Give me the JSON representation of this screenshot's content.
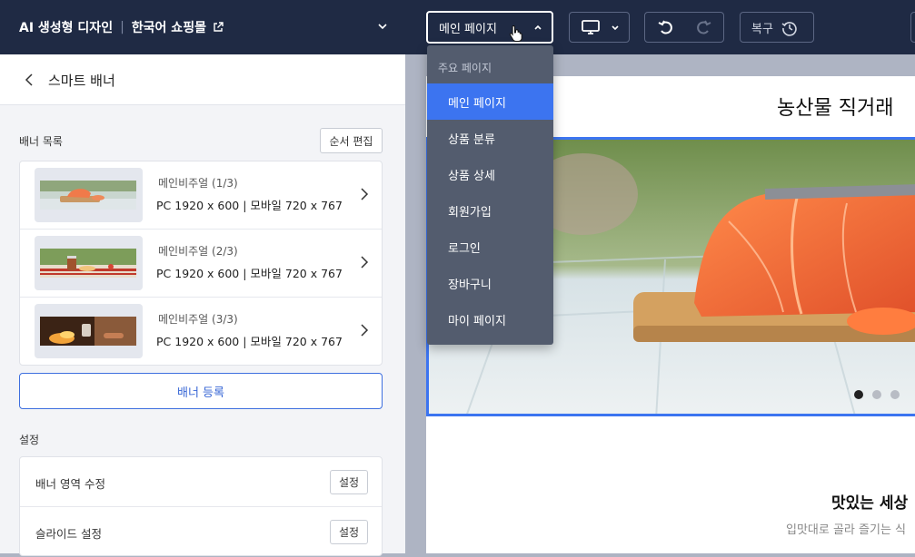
{
  "topbar": {
    "app_title": "AI 생성형 디자인",
    "separator": "|",
    "shop_name": "한국어 쇼핑몰",
    "page_select_value": "메인 페이지",
    "restore_label": "복구"
  },
  "page_dropdown": {
    "group_label": "주요 페이지",
    "items": [
      {
        "label": "메인 페이지",
        "selected": true
      },
      {
        "label": "상품 분류",
        "selected": false
      },
      {
        "label": "상품 상세",
        "selected": false
      },
      {
        "label": "회원가입",
        "selected": false
      },
      {
        "label": "로그인",
        "selected": false
      },
      {
        "label": "장바구니",
        "selected": false
      },
      {
        "label": "마이 페이지",
        "selected": false
      }
    ]
  },
  "panel": {
    "title": "스마트 배너",
    "banner_list_label": "배너 목록",
    "order_edit_label": "순서 편집",
    "banners": [
      {
        "name": "메인비주얼 (1/3)",
        "size": "PC 1920 x 600  |  모바일 720 x 767"
      },
      {
        "name": "메인비주얼 (2/3)",
        "size": "PC 1920 x 600  |  모바일 720 x 767"
      },
      {
        "name": "메인비주얼 (3/3)",
        "size": "PC 1920 x 600  |  모바일 720 x 767"
      }
    ],
    "add_banner_label": "배너 등록",
    "settings_label": "설정",
    "settings": [
      {
        "label": "배너 영역 수정",
        "button": "설정"
      },
      {
        "label": "슬라이드 설정",
        "button": "설정"
      }
    ]
  },
  "preview": {
    "site_title": "농산물 직거래",
    "tagline": "맛있는 세상",
    "subline": "입맛대로 골라 즐기는 식",
    "slider_dots": 3,
    "active_dot": 1
  },
  "colors": {
    "topbar_bg": "#1f2a44",
    "accent": "#3c74f0",
    "dropdown_bg": "#535c6e"
  }
}
